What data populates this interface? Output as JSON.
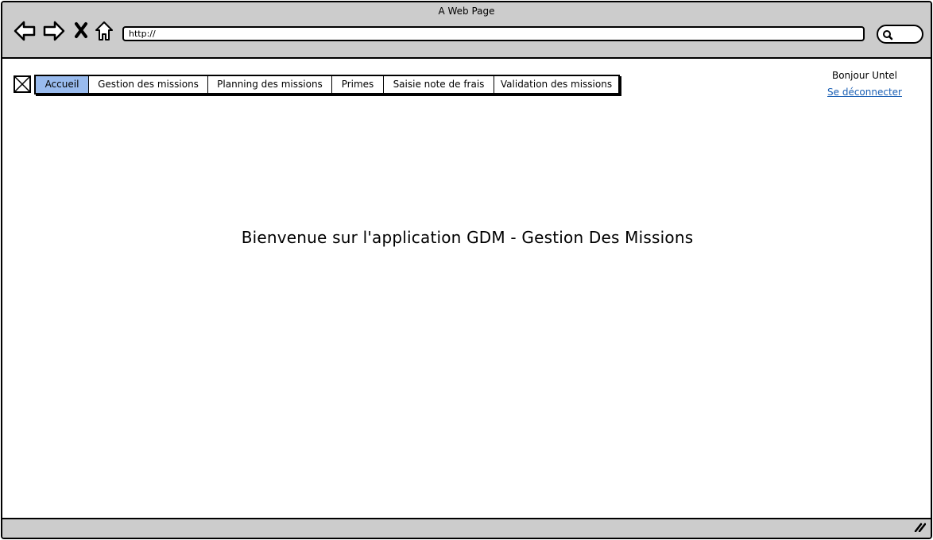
{
  "window": {
    "title": "A Web Page"
  },
  "browser": {
    "url": "http://",
    "icons": [
      "back-icon",
      "forward-icon",
      "stop-icon",
      "home-icon",
      "search-icon"
    ]
  },
  "tabs": [
    {
      "label": "Accueil",
      "active": true
    },
    {
      "label": "Gestion des missions",
      "active": false
    },
    {
      "label": "Planning des missions",
      "active": false
    },
    {
      "label": "Primes",
      "active": false
    },
    {
      "label": "Saisie note de frais",
      "active": false
    },
    {
      "label": "Validation des missions",
      "active": false
    }
  ],
  "user": {
    "greeting": "Bonjour Untel",
    "logout_label": "Se déconnecter"
  },
  "main": {
    "welcome_text": "Bienvenue sur l'application GDM - Gestion Des Missions"
  },
  "colors": {
    "chrome": "#cccccc",
    "active_tab": "#99bbee",
    "link": "#1a5fb4"
  }
}
